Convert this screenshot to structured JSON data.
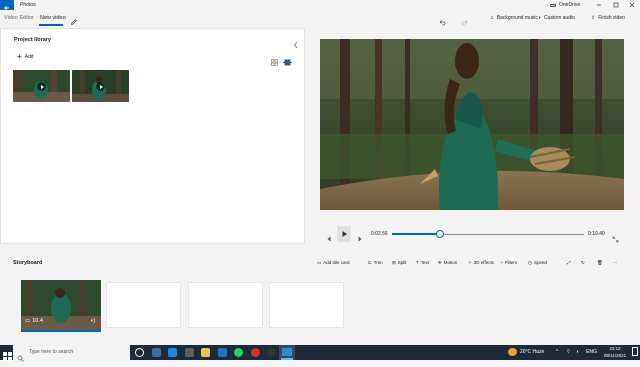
{
  "titlebar": {
    "app_title": "Photos",
    "account": "OneDrive"
  },
  "topbar": {
    "tab_video_editor": "Video Editor",
    "tab_new_video": "New video",
    "background_music": "Background music",
    "custom_audio": "Custom audio",
    "finish_video": "Finish video"
  },
  "library": {
    "title": "Project library",
    "add_label": "Add"
  },
  "player": {
    "current_time": "0:02.56",
    "total_time": "0:10.40",
    "progress": 0.25
  },
  "storyboard": {
    "title": "Storyboard",
    "add_title_card": "Add title card",
    "trim": "Trim",
    "split": "Split",
    "text": "Text",
    "motion": "Motion",
    "effects_3d": "3D effects",
    "filters": "Filters",
    "speed": "Speed",
    "clip_duration": "10.4"
  },
  "taskbar": {
    "search_placeholder": "Type here to search",
    "weather": "20°C  Haze",
    "time": "23:12",
    "date": "08/11/2021"
  },
  "colors": {
    "accent": "#0067c0",
    "taskbar": "#1f2a38"
  }
}
